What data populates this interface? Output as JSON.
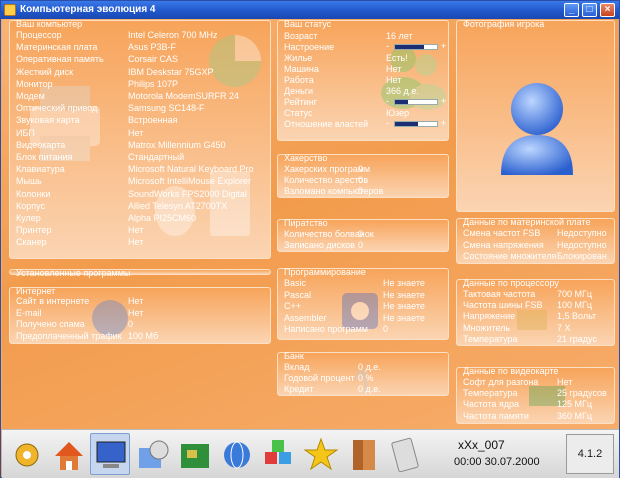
{
  "window": {
    "title": "Компьютерная эволюция 4",
    "min": "_",
    "max": "□",
    "close": "×"
  },
  "computer": {
    "caption": "Ваш компьютер",
    "rows": [
      {
        "k": "Процессор",
        "v": "Intel Celeron 700 MHz"
      },
      {
        "k": "Материнская плата",
        "v": "Asus P3B-F"
      },
      {
        "k": "Оперативная память",
        "v": "Corsair CAS"
      },
      {
        "k": "Жесткий диск",
        "v": "IBM Deskstar 75GXP"
      },
      {
        "k": "Монитор",
        "v": "Philips 107P"
      },
      {
        "k": "Модем",
        "v": "Motorola ModemSURFR 24"
      },
      {
        "k": "Оптический привод",
        "v": "Samsung SC148-F"
      },
      {
        "k": "Звуковая карта",
        "v": "Встроенная"
      },
      {
        "k": "ИБП",
        "v": "Нет"
      },
      {
        "k": "Видеокарта",
        "v": "Matrox Millennium G450"
      },
      {
        "k": "Блок питания",
        "v": "Стандартный"
      },
      {
        "k": "Клавиатура",
        "v": "Microsoft Natural Keyboard Pro"
      },
      {
        "k": "Мышь",
        "v": "Microsoft IntelliMouse Explorer"
      },
      {
        "k": "Колонки",
        "v": "SoundWorks FPS2000 Digital"
      },
      {
        "k": "Корпус",
        "v": "Allied Telesyn AT2700TX"
      },
      {
        "k": "Кулер",
        "v": "Alpha PI25CM60"
      },
      {
        "k": "Принтер",
        "v": "Нет"
      },
      {
        "k": "Сканер",
        "v": "Нет"
      }
    ]
  },
  "status": {
    "caption": "Ваш статус",
    "age": {
      "k": "Возраст",
      "v": "16 лет"
    },
    "mood": {
      "k": "Настроение",
      "level": 0.7
    },
    "housing": {
      "k": "Жилье",
      "v": "Есть!"
    },
    "car": {
      "k": "Машина",
      "v": "Нет"
    },
    "job": {
      "k": "Работа",
      "v": "Нет"
    },
    "money": {
      "k": "Деньги",
      "v": "366 д.е."
    },
    "rating": {
      "k": "Рейтинг",
      "level": 0.3
    },
    "st": {
      "k": "Статус",
      "v": "Юзер"
    },
    "authorities": {
      "k": "Отношение властей",
      "level": 0.55
    },
    "minus": "-",
    "plus": "+"
  },
  "photo": {
    "caption": "Фотография игрока"
  },
  "hacking": {
    "caption": "Хакерство",
    "rows": [
      {
        "k": "Хакерских программ",
        "v": "0"
      },
      {
        "k": "Количество арестов",
        "v": "0"
      },
      {
        "k": "Взломано компьютеров",
        "v": "0"
      }
    ]
  },
  "piracy": {
    "caption": "Пиратство",
    "rows": [
      {
        "k": "Количество болванок",
        "v": "0"
      },
      {
        "k": "Записано дисков",
        "v": "0"
      }
    ]
  },
  "programming": {
    "caption": "Программирование",
    "rows": [
      {
        "k": "Basic",
        "v": "Не знаете"
      },
      {
        "k": "Pascal",
        "v": "Не знаете"
      },
      {
        "k": "C++",
        "v": "Не знаете"
      },
      {
        "k": "Assembler",
        "v": "Не знаете"
      },
      {
        "k": "Написано программ",
        "v": "0"
      }
    ]
  },
  "bank": {
    "caption": "Банк",
    "rows": [
      {
        "k": "Вклад",
        "v": "0 д.е."
      },
      {
        "k": "Годовой процент",
        "v": "0 %"
      },
      {
        "k": "Кредит",
        "v": "0 д.е."
      }
    ]
  },
  "installed": {
    "caption": "Установленные программы"
  },
  "internet": {
    "caption": "Интернет",
    "rows": [
      {
        "k": "Сайт в интернете",
        "v": "Нет"
      },
      {
        "k": "E-mail",
        "v": "Нет"
      },
      {
        "k": "Получено спама",
        "v": "0"
      },
      {
        "k": "Предоплаченный трафик",
        "v": "100 Мб"
      }
    ]
  },
  "motherboard": {
    "caption": "Данные по материнской плате",
    "rows": [
      {
        "k": "Смена частот FSB",
        "v": "Недоступно"
      },
      {
        "k": "Смена напряжения",
        "v": "Недоступно"
      },
      {
        "k": "Состояние множителя",
        "v": "Блокирован"
      }
    ]
  },
  "cpu": {
    "caption": "Данные по процессору",
    "rows": [
      {
        "k": "Тактовая частота",
        "v": "700 МГц"
      },
      {
        "k": "Частота шины FSB",
        "v": "100 МГц"
      },
      {
        "k": "Напряжение",
        "v": "1,5 Вольт"
      },
      {
        "k": "Множитель",
        "v": "7 X"
      },
      {
        "k": "Температура",
        "v": "21 градус"
      }
    ]
  },
  "gpu": {
    "caption": "Данные по видеокарте",
    "rows": [
      {
        "k": "Софт для разгона",
        "v": "Нет"
      },
      {
        "k": "Температура",
        "v": "25 градусов"
      },
      {
        "k": "Частота ядра",
        "v": "125 МГц"
      },
      {
        "k": "Частота памяти",
        "v": "360 МГц"
      }
    ]
  },
  "taskbar": {
    "nick": "xXx_007",
    "datetime": "00:00 30.07.2000",
    "version": "4.1.2",
    "buttons": [
      "settings-icon",
      "home-icon",
      "computer-icon",
      "software-icon",
      "motherboard-icon",
      "internet-icon",
      "components-icon",
      "favorites-icon",
      "door-icon",
      "calculator-icon"
    ]
  }
}
